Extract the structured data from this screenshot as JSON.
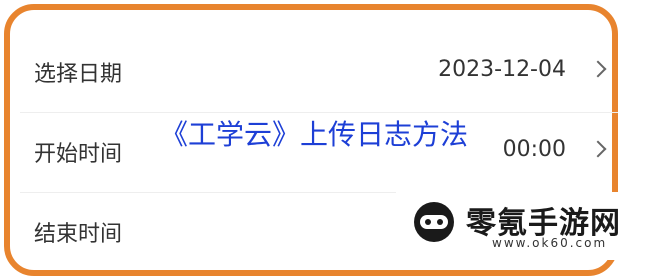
{
  "form": {
    "rows": [
      {
        "label": "选择日期",
        "value": "2023-12-04"
      },
      {
        "label": "开始时间",
        "value": "00:00"
      },
      {
        "label": "结束时间",
        "value": ""
      }
    ]
  },
  "overlay": {
    "title": "《工学云》上传日志方法"
  },
  "watermark": {
    "name": "零氪手游网",
    "url": "www.ok60.com"
  },
  "colors": {
    "frame_border": "#e8842e",
    "title_text": "#1d3fd6"
  },
  "icons": {
    "row_chevron": "chevron-right-icon",
    "watermark_logo": "gamepad-icon"
  }
}
